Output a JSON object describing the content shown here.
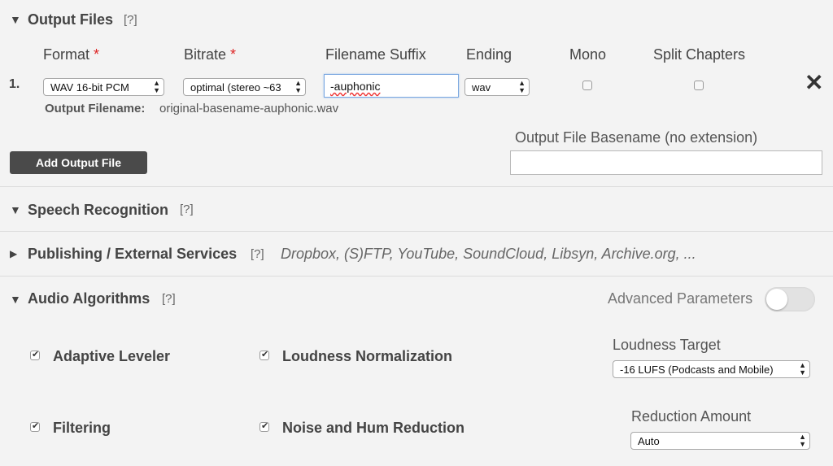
{
  "output_files": {
    "title": "Output Files",
    "help": "[?]",
    "columns": {
      "format": "Format",
      "bitrate": "Bitrate",
      "suffix": "Filename Suffix",
      "ending": "Ending",
      "mono": "Mono",
      "split": "Split Chapters"
    },
    "required_mark": "*",
    "row": {
      "index": "1.",
      "format": "WAV 16-bit PCM",
      "bitrate": "optimal (stereo ~63",
      "suffix": "-auphonic",
      "ending": "wav",
      "mono": false,
      "split_chapters": false,
      "remove": "✕",
      "filename_label": "Output Filename:",
      "filename_value": "original-basename-auphonic.wav"
    },
    "add_button": "Add Output File",
    "basename_label": "Output File Basename (no extension)",
    "basename_value": ""
  },
  "speech_recognition": {
    "title": "Speech Recognition",
    "help": "[?]"
  },
  "publishing": {
    "title": "Publishing / External Services",
    "help": "[?]",
    "services": "Dropbox, (S)FTP, YouTube, SoundCloud, Libsyn, Archive.org, ..."
  },
  "audio_algorithms": {
    "title": "Audio Algorithms",
    "help": "[?]",
    "advanced_label": "Advanced Parameters",
    "advanced_on": false,
    "adaptive_leveler": "Adaptive Leveler",
    "loudness_normalization": "Loudness Normalization",
    "filtering": "Filtering",
    "noise_hum": "Noise and Hum Reduction",
    "loudness_target_label": "Loudness Target",
    "loudness_target_value": "-16 LUFS (Podcasts and Mobile)",
    "reduction_label": "Reduction Amount",
    "reduction_value": "Auto"
  },
  "icons": {
    "expanded": "▼",
    "collapsed": "▶",
    "select_arrows": "▲▼"
  },
  "colors": {
    "background": "#f3f3f3",
    "button": "#4a4a4a",
    "required": "#dd2222",
    "focus_border": "#7aa7e0"
  }
}
